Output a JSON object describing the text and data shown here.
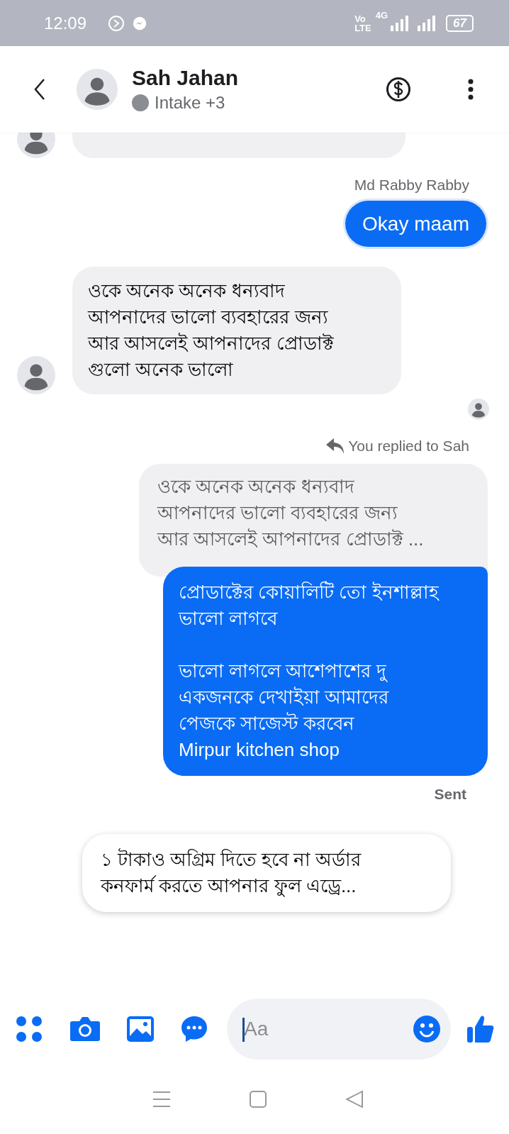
{
  "status_bar": {
    "time": "12:09",
    "volte_top": "Vo",
    "volte_bottom": "LTE",
    "network": "4G",
    "battery": "67"
  },
  "header": {
    "name": "Sah Jahan",
    "subtitle": "Intake +3"
  },
  "messages": [
    {
      "kind": "incoming_cut"
    },
    {
      "kind": "sender",
      "text": "Md Rabby Rabby"
    },
    {
      "kind": "outgoing",
      "text": "Okay maam"
    },
    {
      "kind": "incoming",
      "text": "ওকে অনেক অনেক ধন্যবাদ\nআপনাদের ভালো ব্যবহারের জন্য\nআর আসলেই আপনাদের প্রোডাক্ট\nগুলো অনেক ভালো"
    },
    {
      "kind": "seen"
    },
    {
      "kind": "reply_label",
      "text": "You replied to Sah"
    },
    {
      "kind": "quoted",
      "text": "ওকে অনেক অনেক ধন্যবাদ\nআপনাদের ভালো ব্যবহারের জন্য\nআর আসলেই আপনাদের প্রোডাক্ট ..."
    },
    {
      "kind": "outgoing_long",
      "text": "প্রোডাক্টের কোয়ালিটি তো ইনশাল্লাহ\nভালো লাগবে\n\nভালো লাগলে আশেপাশের দু\nএকজনকে দেখাইয়া আমাদের\nপেজকে সাজেস্ট করবেন\nMirpur kitchen shop"
    },
    {
      "kind": "status",
      "text": "Sent"
    },
    {
      "kind": "preview",
      "text": "১ টাকাও অগ্রিম দিতে হবে না অর্ডার\nকনফার্ম করতে আপনার ফুল এড্রে..."
    }
  ],
  "composer": {
    "placeholder": "Aa"
  }
}
